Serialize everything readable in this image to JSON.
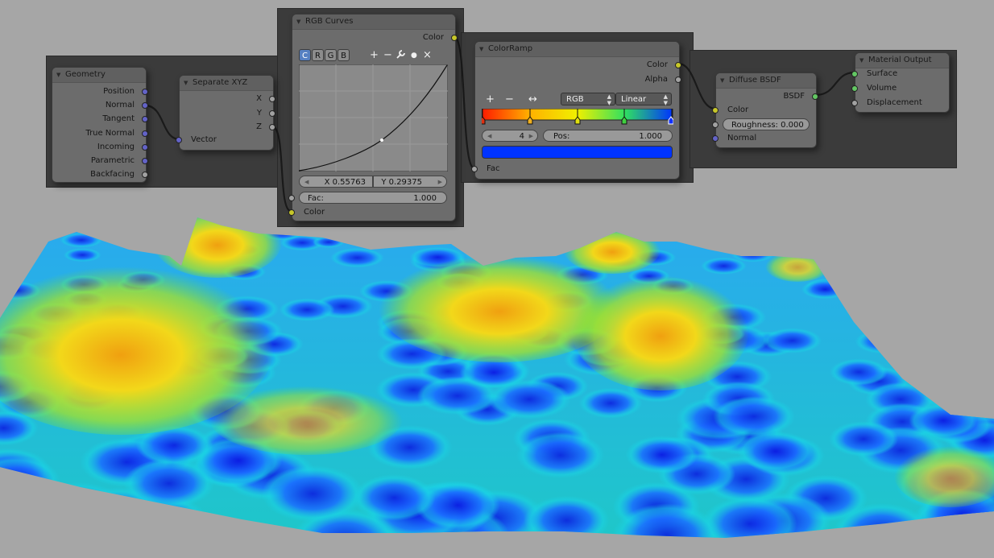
{
  "nodes": {
    "geometry": {
      "title": "Geometry",
      "outputs": [
        "Position",
        "Normal",
        "Tangent",
        "True Normal",
        "Incoming",
        "Parametric",
        "Backfacing"
      ]
    },
    "separate_xyz": {
      "title": "Separate XYZ",
      "outputs": [
        "X",
        "Y",
        "Z"
      ],
      "input": "Vector"
    },
    "rgb_curves": {
      "title": "RGB Curves",
      "output": "Color",
      "tabs": [
        "C",
        "R",
        "G",
        "B"
      ],
      "active_tab": "C",
      "tools": [
        "+",
        "−",
        "wrench",
        "●",
        "×"
      ],
      "x_value": "X 0.55763",
      "y_value": "Y 0.29375",
      "fac_label": "Fac:",
      "fac_value": "1.000",
      "input": "Color"
    },
    "color_ramp": {
      "title": "ColorRamp",
      "outputs": [
        "Color",
        "Alpha"
      ],
      "tools": [
        "+",
        "−",
        "↔"
      ],
      "color_mode": "RGB",
      "interpolation": "Linear",
      "index": "4",
      "pos_label": "Pos:",
      "pos_value": "1.000",
      "active_color": "#0033ff",
      "input": "Fac"
    },
    "diffuse_bsdf": {
      "title": "Diffuse BSDF",
      "output": "BSDF",
      "inputs": [
        "Color",
        "Normal"
      ],
      "roughness": "Roughness: 0.000"
    },
    "material_output": {
      "title": "Material Output",
      "inputs": [
        "Surface",
        "Volume",
        "Displacement"
      ]
    }
  },
  "colors": {
    "node_bg": "#6c6c6c",
    "editor_bg": "#3b3b3b",
    "viewport_bg": "#a6a6a6",
    "socket_vector": "#6363c7",
    "socket_color": "#c7c729",
    "socket_float": "#a1a1a1",
    "socket_shader": "#63c763",
    "active_tab": "#5680c2"
  }
}
